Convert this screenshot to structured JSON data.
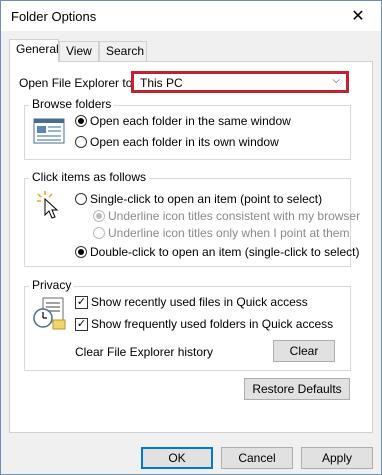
{
  "window": {
    "title": "Folder Options",
    "close_symbol": "✕"
  },
  "tabs": [
    {
      "label": "General",
      "active": true
    },
    {
      "label": "View",
      "active": false
    },
    {
      "label": "Search",
      "active": false
    }
  ],
  "open_explorer": {
    "label": "Open File Explorer to:",
    "value": "This PC"
  },
  "browse_folders": {
    "title": "Browse folders",
    "options": [
      {
        "label": "Open each folder in the same window",
        "checked": true
      },
      {
        "label": "Open each folder in its own window",
        "checked": false
      }
    ]
  },
  "click_items": {
    "title": "Click items as follows",
    "single_click": "Single-click to open an item (point to select)",
    "underline_consistent": "Underline icon titles consistent with my browser",
    "underline_point": "Underline icon titles only when I point at them",
    "double_click": "Double-click to open an item (single-click to select)"
  },
  "privacy": {
    "title": "Privacy",
    "recent_files": "Show recently used files in Quick access",
    "frequent_folders": "Show frequently used folders in Quick access",
    "clear_history_label": "Clear File Explorer history",
    "clear_button": "Clear"
  },
  "buttons": {
    "restore_defaults": "Restore Defaults",
    "ok": "OK",
    "cancel": "Cancel",
    "apply": "Apply"
  },
  "colors": {
    "highlight": "#c4202e",
    "accent": "#0078d7"
  }
}
